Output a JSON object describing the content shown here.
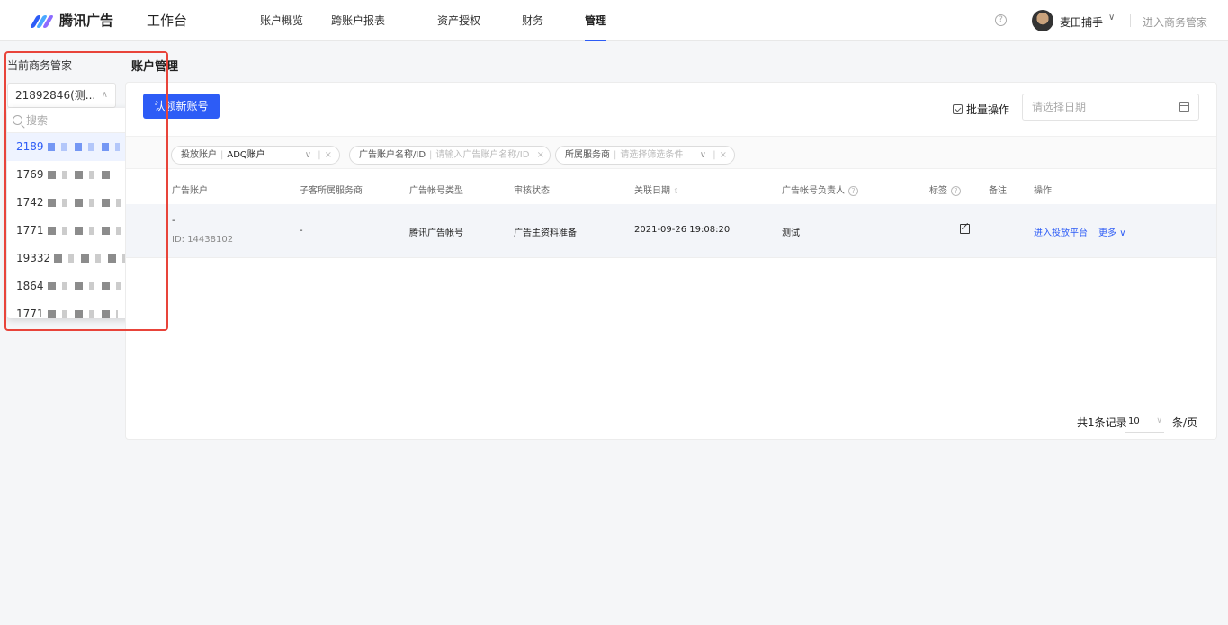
{
  "brand": {
    "name": "腾讯广告",
    "workspace": "工作台"
  },
  "nav": [
    "账户概览",
    "跨账户报表",
    "资产授权",
    "财务",
    "管理"
  ],
  "nav_active": "管理",
  "user": {
    "name": "麦田捕手",
    "enter_label": "进入商务管家"
  },
  "sidebar": {
    "label": "当前商务管家",
    "selected": "21892846(测...",
    "search_placeholder": "搜索",
    "options": [
      "2189",
      "1769",
      "1742",
      "1771",
      "19332",
      "1864",
      "1771"
    ]
  },
  "page": {
    "title": "账户管理"
  },
  "toolbar": {
    "add_button": "认领新账号",
    "batch_label": "批量操作",
    "date_placeholder": "请选择日期"
  },
  "filters": {
    "account_label": "投放账户",
    "account_value": "ADQ账户",
    "name_label": "广告账户名称/ID",
    "name_placeholder": "请输入广告账户名称/ID",
    "provider_label": "所属服务商",
    "provider_placeholder": "请选择筛选条件"
  },
  "columns": [
    "广告账户",
    "子客所属服务商",
    "广告帐号类型",
    "审核状态",
    "关联日期",
    "广告帐号负责人",
    "标签",
    "备注",
    "操作"
  ],
  "row": {
    "account_name": "-",
    "account_id": "ID: 14438102",
    "provider": "-",
    "type": "腾讯广告帐号",
    "status": "广告主资料准备",
    "date": "2021-09-26 19:08:20",
    "owner": "测试",
    "action_enter": "进入投放平台",
    "action_more": "更多"
  },
  "pagination": {
    "total": "共1条记录",
    "page_size": "10",
    "per_page": "条/页"
  },
  "colors": {
    "primary": "#2d5cf6",
    "highlight": "#e8443a"
  }
}
